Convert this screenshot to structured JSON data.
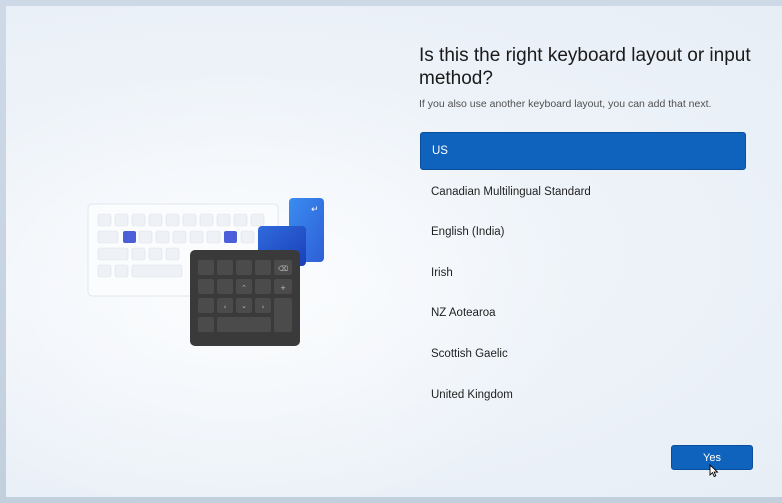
{
  "page": {
    "title": "Is this the right keyboard layout or input method?",
    "subtitle": "If you also use another keyboard layout, you can add that next."
  },
  "layouts": [
    {
      "label": "US",
      "selected": true
    },
    {
      "label": "Canadian Multilingual Standard",
      "selected": false
    },
    {
      "label": "English (India)",
      "selected": false
    },
    {
      "label": "Irish",
      "selected": false
    },
    {
      "label": "NZ Aotearoa",
      "selected": false
    },
    {
      "label": "Scottish Gaelic",
      "selected": false
    },
    {
      "label": "United Kingdom",
      "selected": false
    }
  ],
  "actions": {
    "yes_label": "Yes"
  },
  "colors": {
    "accent": "#0f63bd",
    "key_accent": "#4a5fd8",
    "numpad": "#3a3a3a"
  },
  "icons": [
    "keyboard-illustration",
    "enter-key-icon",
    "backspace-icon",
    "arrow-up-icon",
    "arrow-down-icon",
    "arrow-left-icon",
    "arrow-right-icon",
    "plus-icon",
    "mouse-cursor-icon"
  ]
}
